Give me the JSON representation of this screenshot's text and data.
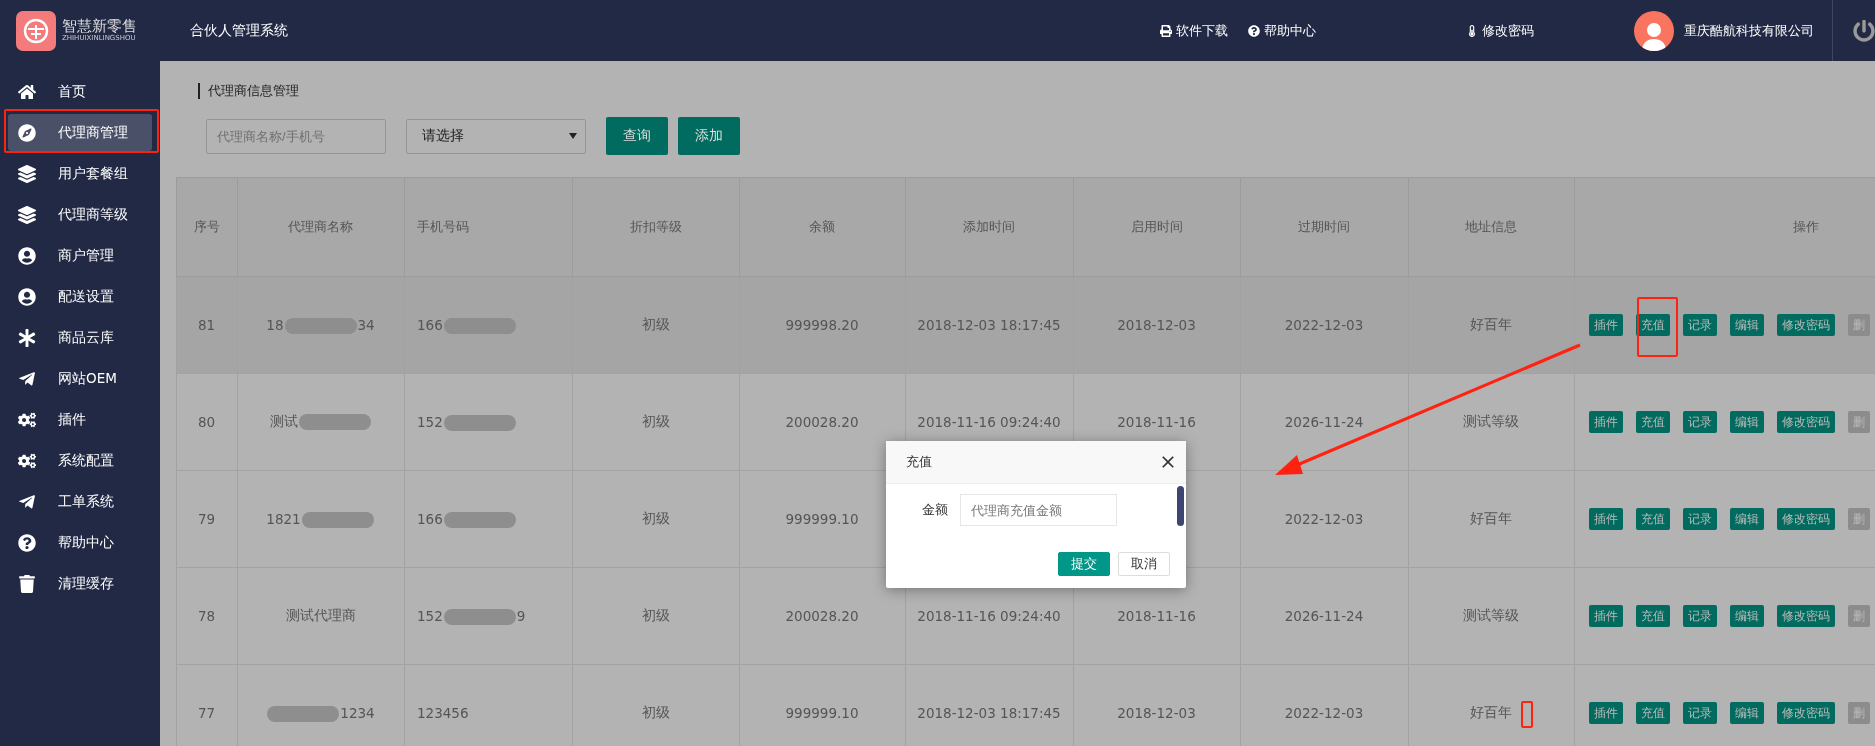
{
  "header": {
    "logo_title": "智慧新零售",
    "logo_subtitle": "ZHIHUIXINLINGSHOU",
    "system_title": "合伙人管理系统",
    "links": [
      "软件下载",
      "帮助中心",
      "修改密码"
    ],
    "company": "重庆酷航科技有限公司"
  },
  "sidebar": {
    "items": [
      {
        "label": "首页",
        "selected": false
      },
      {
        "label": "代理商管理",
        "selected": true
      },
      {
        "label": "用户套餐组",
        "selected": false
      },
      {
        "label": "代理商等级",
        "selected": false
      },
      {
        "label": "商户管理",
        "selected": false
      },
      {
        "label": "配送设置",
        "selected": false
      },
      {
        "label": "商品云库",
        "selected": false
      },
      {
        "label": "网站OEM",
        "selected": false
      },
      {
        "label": "插件",
        "selected": false
      },
      {
        "label": "系统配置",
        "selected": false
      },
      {
        "label": "工单系统",
        "selected": false
      },
      {
        "label": "帮助中心",
        "selected": false
      },
      {
        "label": "清理缓存",
        "selected": false
      }
    ]
  },
  "breadcrumb": "代理商信息管理",
  "filters": {
    "search_placeholder": "代理商名称/手机号",
    "select_value": "请选择",
    "buttons": [
      "查询",
      "添加"
    ]
  },
  "table": {
    "columns": [
      "序号",
      "代理商名称",
      "手机号码",
      "折扣等级",
      "余额",
      "添加时间",
      "启用时间",
      "过期时间",
      "地址信息",
      "操作"
    ],
    "rows": [
      {
        "id": "81",
        "highlighted": true,
        "name": {
          "start": "18",
          "end": "34",
          "redacted": true
        },
        "phone": {
          "start": "166",
          "redacted": true
        },
        "level": "初级",
        "balance": "999998.20",
        "added": "2018-12-03 18:17:45",
        "enabled": "2018-12-03",
        "expires": "2022-12-03",
        "address": "好百年",
        "actions": [
          {
            "label": "插件",
            "kind": "primary"
          },
          {
            "label": "充值",
            "kind": "primary"
          },
          {
            "label": "记录",
            "kind": "primary"
          },
          {
            "label": "编辑",
            "kind": "primary"
          },
          {
            "label": "修改密码",
            "kind": "primary"
          },
          {
            "label": "删",
            "kind": "muted"
          }
        ]
      },
      {
        "id": "80",
        "highlighted": false,
        "name": {
          "start": "测试",
          "redacted": true
        },
        "phone": {
          "start": "152",
          "redacted": true
        },
        "level": "初级",
        "balance": "200028.20",
        "added": "2018-11-16 09:24:40",
        "enabled": "2018-11-16",
        "expires": "2026-11-24",
        "address": "测试等级",
        "actions": [
          {
            "label": "插件",
            "kind": "primary"
          },
          {
            "label": "充值",
            "kind": "primary"
          },
          {
            "label": "记录",
            "kind": "primary"
          },
          {
            "label": "编辑",
            "kind": "primary"
          },
          {
            "label": "修改密码",
            "kind": "primary"
          },
          {
            "label": "删",
            "kind": "muted"
          }
        ]
      },
      {
        "id": "79",
        "highlighted": false,
        "name": {
          "start": "1821",
          "redacted": true
        },
        "phone": {
          "start": "166",
          "redacted": true
        },
        "level": "初级",
        "balance": "999999.10",
        "expires": "2022-12-03",
        "address": "好百年",
        "actions": [
          {
            "label": "插件",
            "kind": "primary"
          },
          {
            "label": "充值",
            "kind": "primary"
          },
          {
            "label": "记录",
            "kind": "primary"
          },
          {
            "label": "编辑",
            "kind": "primary"
          },
          {
            "label": "修改密码",
            "kind": "primary"
          },
          {
            "label": "删",
            "kind": "muted"
          }
        ]
      },
      {
        "id": "78",
        "highlighted": false,
        "name": {
          "start": "测试代理商",
          "redacted": false
        },
        "phone": {
          "start": "152",
          "end": "9",
          "redacted": true
        },
        "level": "初级",
        "balance": "200028.20",
        "added": "2018-11-16 09:24:40",
        "enabled": "2018-11-16",
        "expires": "2026-11-24",
        "address": "测试等级",
        "actions": [
          {
            "label": "插件",
            "kind": "primary"
          },
          {
            "label": "充值",
            "kind": "primary"
          },
          {
            "label": "记录",
            "kind": "primary"
          },
          {
            "label": "编辑",
            "kind": "primary"
          },
          {
            "label": "修改密码",
            "kind": "primary"
          },
          {
            "label": "删",
            "kind": "muted"
          }
        ]
      },
      {
        "id": "77",
        "highlighted": false,
        "name": {
          "end": "1234",
          "redacted": true
        },
        "phone": {
          "start": "123456",
          "redacted": false
        },
        "level": "初级",
        "balance": "999999.10",
        "added": "2018-12-03 18:17:45",
        "enabled": "2018-12-03",
        "expires": "2022-12-03",
        "address": "好百年",
        "actions": [
          {
            "label": "插件",
            "kind": "primary"
          },
          {
            "label": "充值",
            "kind": "primary"
          },
          {
            "label": "记录",
            "kind": "primary"
          },
          {
            "label": "编辑",
            "kind": "primary"
          },
          {
            "label": "修改密码",
            "kind": "primary"
          },
          {
            "label": "删",
            "kind": "muted"
          }
        ]
      }
    ]
  },
  "dialog": {
    "title": "充值",
    "field_label": "金额",
    "field_placeholder": "代理商充值金额",
    "buttons": [
      "提交",
      "取消"
    ]
  }
}
